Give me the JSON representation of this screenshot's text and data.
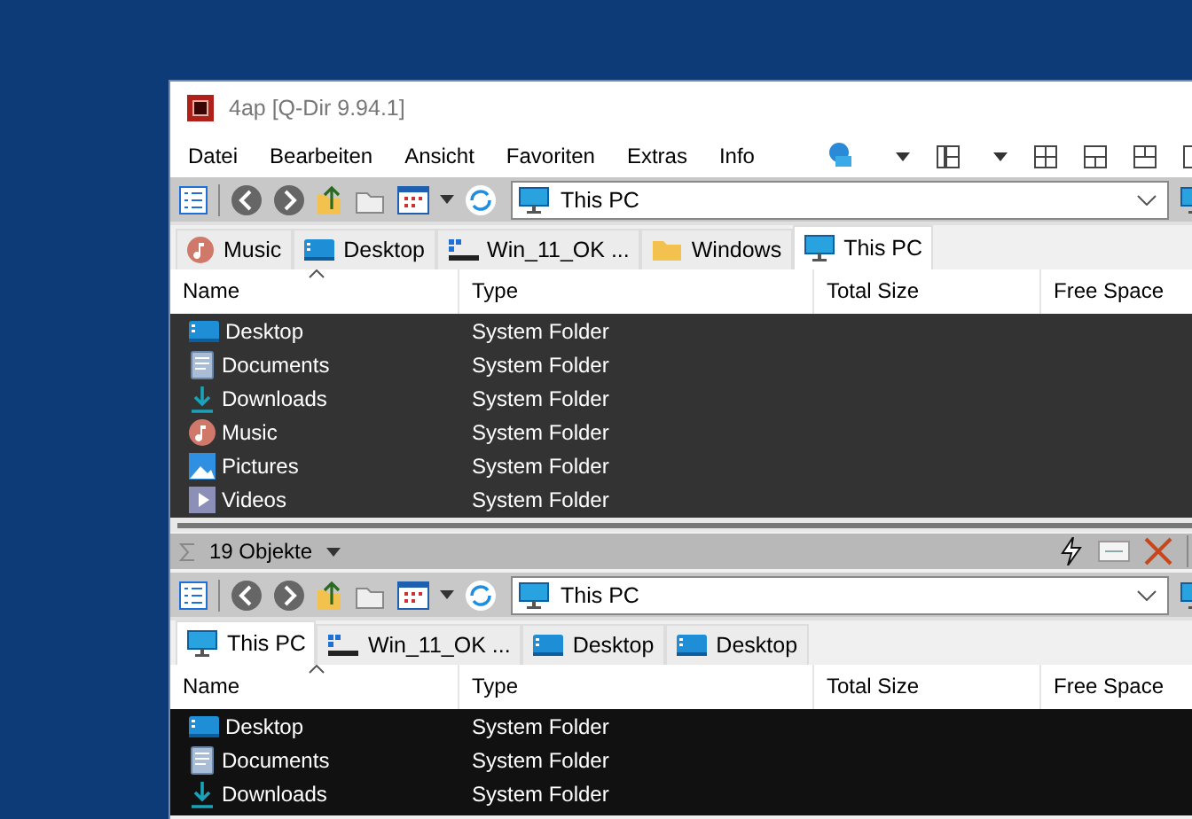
{
  "window": {
    "title": "4ap  [Q-Dir 9.94.1]"
  },
  "menu": [
    "Datei",
    "Bearbeiten",
    "Ansicht",
    "Favoriten",
    "Extras",
    "Info"
  ],
  "panes": [
    {
      "focused": false,
      "address": "This PC",
      "tabs": [
        {
          "label": "Music",
          "kind": "music",
          "selected": false
        },
        {
          "label": "Desktop",
          "kind": "desktop",
          "selected": false
        },
        {
          "label": "Win_11_OK ...",
          "kind": "drive",
          "selected": false
        },
        {
          "label": "Windows",
          "kind": "folder",
          "selected": false
        },
        {
          "label": "This PC",
          "kind": "pc",
          "selected": true
        }
      ],
      "columns": [
        "Name",
        "Type",
        "Total Size",
        "Free Space"
      ],
      "rows": [
        {
          "name": "Desktop",
          "kind": "desktop",
          "type": "System Folder"
        },
        {
          "name": "Documents",
          "kind": "documents",
          "type": "System Folder"
        },
        {
          "name": "Downloads",
          "kind": "downloads",
          "type": "System Folder"
        },
        {
          "name": "Music",
          "kind": "music",
          "type": "System Folder"
        },
        {
          "name": "Pictures",
          "kind": "pictures",
          "type": "System Folder"
        },
        {
          "name": "Videos",
          "kind": "videos",
          "type": "System Folder"
        }
      ]
    },
    {
      "focused": true,
      "address": "This PC",
      "tabs": [
        {
          "label": "This PC",
          "kind": "pc",
          "selected": true
        },
        {
          "label": "Win_11_OK ...",
          "kind": "drive",
          "selected": false
        },
        {
          "label": "Desktop",
          "kind": "desktop",
          "selected": false
        },
        {
          "label": "Desktop",
          "kind": "desktop",
          "selected": false
        }
      ],
      "columns": [
        "Name",
        "Type",
        "Total Size",
        "Free Space"
      ],
      "rows": [
        {
          "name": "Desktop",
          "kind": "desktop",
          "type": "System Folder"
        },
        {
          "name": "Documents",
          "kind": "documents",
          "type": "System Folder"
        },
        {
          "name": "Downloads",
          "kind": "downloads",
          "type": "System Folder"
        }
      ]
    }
  ],
  "status_bar": {
    "count": "19 Objekte"
  }
}
